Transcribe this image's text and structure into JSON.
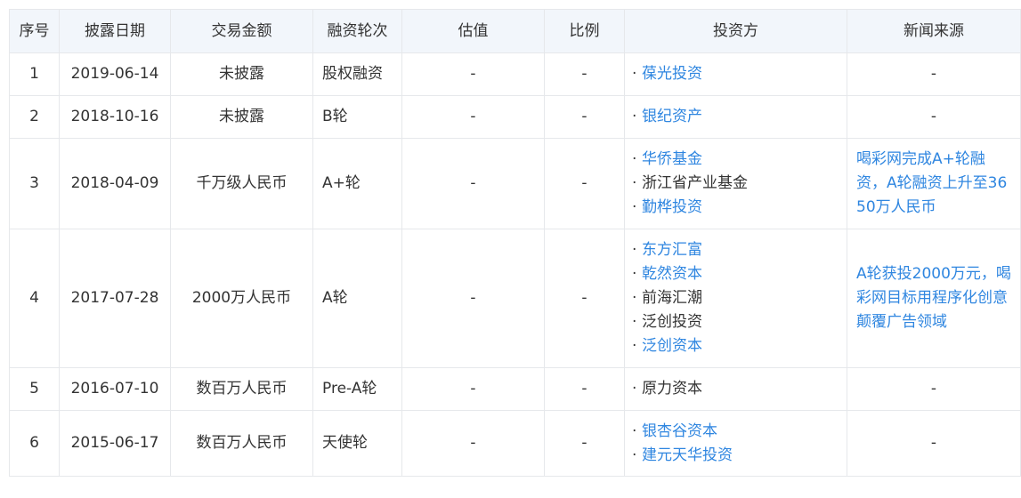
{
  "headers": [
    "序号",
    "披露日期",
    "交易金额",
    "融资轮次",
    "估值",
    "比例",
    "投资方",
    "新闻来源"
  ],
  "rows": [
    {
      "no": "1",
      "date": "2019-06-14",
      "amount": "未披露",
      "round": "股权融资",
      "valuation": "-",
      "ratio": "-",
      "investors": [
        {
          "name": "葆光投资",
          "link": true
        }
      ],
      "news": "-"
    },
    {
      "no": "2",
      "date": "2018-10-16",
      "amount": "未披露",
      "round": "B轮",
      "valuation": "-",
      "ratio": "-",
      "investors": [
        {
          "name": "银纪资产",
          "link": true
        }
      ],
      "news": "-"
    },
    {
      "no": "3",
      "date": "2018-04-09",
      "amount": "千万级人民币",
      "round": "A+轮",
      "valuation": "-",
      "ratio": "-",
      "investors": [
        {
          "name": "华侨基金",
          "link": true
        },
        {
          "name": "浙江省产业基金",
          "link": false
        },
        {
          "name": "勤桦投资",
          "link": true
        }
      ],
      "news": "喝彩网完成A+轮融资，A轮融资上升至3650万人民币"
    },
    {
      "no": "4",
      "date": "2017-07-28",
      "amount": "2000万人民币",
      "round": "A轮",
      "valuation": "-",
      "ratio": "-",
      "investors": [
        {
          "name": "东方汇富",
          "link": true
        },
        {
          "name": "乾然资本",
          "link": true
        },
        {
          "name": "前海汇潮",
          "link": false
        },
        {
          "name": "泛创投资",
          "link": false
        },
        {
          "name": "泛创资本",
          "link": true
        }
      ],
      "news": "A轮获投2000万元，喝彩网目标用程序化创意颠覆广告领域"
    },
    {
      "no": "5",
      "date": "2016-07-10",
      "amount": "数百万人民币",
      "round": "Pre-A轮",
      "valuation": "-",
      "ratio": "-",
      "investors": [
        {
          "name": "原力资本",
          "link": false
        }
      ],
      "news": "-"
    },
    {
      "no": "6",
      "date": "2015-06-17",
      "amount": "数百万人民币",
      "round": "天使轮",
      "valuation": "-",
      "ratio": "-",
      "investors": [
        {
          "name": "银杏谷资本",
          "link": true
        },
        {
          "name": "建元天华投资",
          "link": true
        }
      ],
      "news": "-"
    }
  ],
  "colors": {
    "link": "#2f86e0",
    "header_bg": "#f2f6fb",
    "border": "#e6e8eb"
  }
}
